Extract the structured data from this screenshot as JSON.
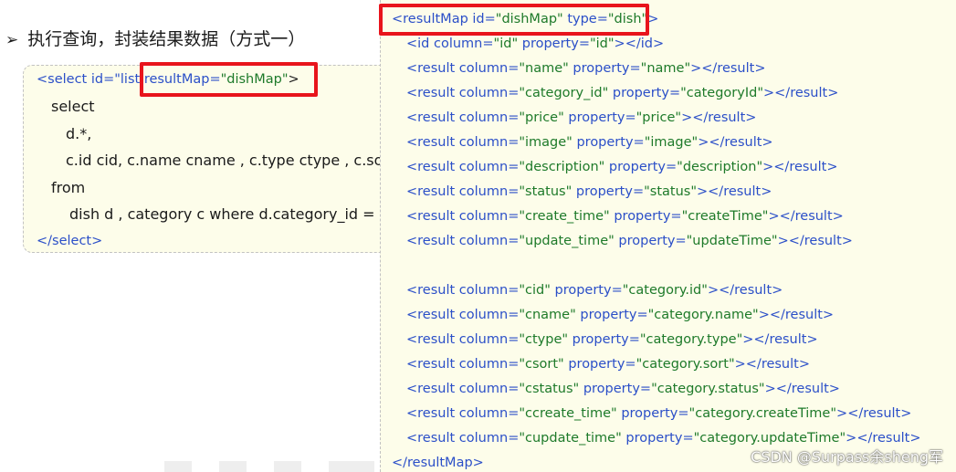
{
  "heading": {
    "bullet": "➢",
    "text": "执行查询，封装结果数据（方式一）"
  },
  "select_block": {
    "open_pre": "<select id=\"list",
    "open_attr": "resultMap",
    "open_eq": "=",
    "open_val": "\"dishMap\"",
    "open_close": ">",
    "line_select": "select",
    "line_d": "d.*,",
    "line_c": "c.id cid, c.name cname , c.type ctype , c.sort",
    "line_from": "from",
    "line_tables": "dish d , category c where d.category_id = c.",
    "close": "</select>"
  },
  "result_map": {
    "open": {
      "tag": "resultMap",
      "attrs": [
        {
          "name": "id",
          "value": "\"dishMap\""
        },
        {
          "name": "type",
          "value": "\"dish\""
        }
      ]
    },
    "id_row": {
      "tag": "id",
      "column": "\"id\"",
      "property": "\"id\"",
      "close": "</id>"
    },
    "rows": [
      {
        "column": "\"name\"",
        "property": "\"name\""
      },
      {
        "column": "\"category_id\"",
        "property": "\"categoryId\""
      },
      {
        "column": "\"price\"",
        "property": "\"price\""
      },
      {
        "column": "\"image\"",
        "property": "\"image\""
      },
      {
        "column": "\"description\"",
        "property": "\"description\""
      },
      {
        "column": "\"status\"",
        "property": "\"status\""
      },
      {
        "column": "\"create_time\"",
        "property": "\"createTime\""
      },
      {
        "column": "\"update_time\"",
        "property": "\"updateTime\""
      },
      {
        "column": "\"cid\"",
        "property": "\"category.id\""
      },
      {
        "column": "\"cname\"",
        "property": "\"category.name\""
      },
      {
        "column": "\"ctype\"",
        "property": "\"category.type\""
      },
      {
        "column": "\"csort\"",
        "property": "\"category.sort\""
      },
      {
        "column": "\"cstatus\"",
        "property": "\"category.status\""
      },
      {
        "column": "\"ccreate_time\"",
        "property": "\"category.createTime\""
      },
      {
        "column": "\"cupdate_time\"",
        "property": "\"category.updateTime\""
      }
    ],
    "result_tag": "result",
    "column_attr": "column",
    "property_attr": "property",
    "result_close": "</result>",
    "close": "</resultMap>"
  },
  "watermark": "CSDN @Surpass余sheng军",
  "colors": {
    "attr": "#2b4fc8",
    "value": "#1e7a2a",
    "highlight": "#e8141c",
    "panel": "#fdfdea"
  }
}
